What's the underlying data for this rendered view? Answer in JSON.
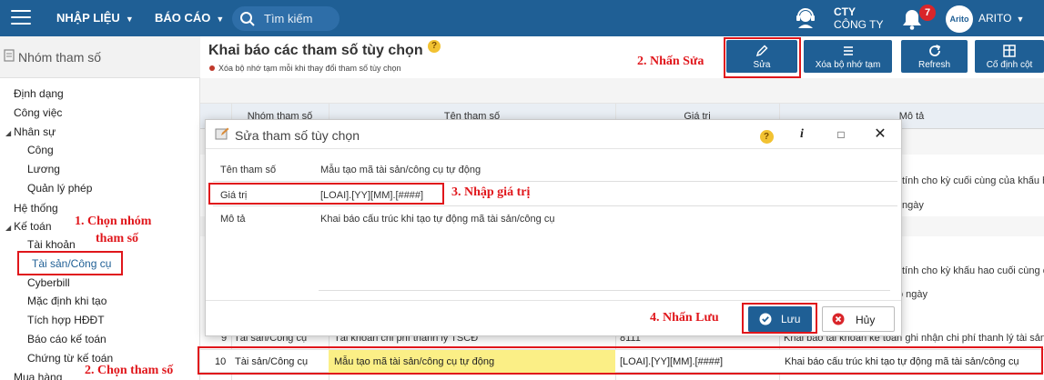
{
  "topbar": {
    "menu1": "NHẬP LIỆU",
    "menu2": "BÁO CÁO",
    "search_placeholder": "Tìm kiếm",
    "company_line1": "CTY",
    "company_line2": "CÔNG TY",
    "notification_count": "7",
    "avatar_text": "Arito",
    "user": "ARITO",
    "color": "#1f5f95"
  },
  "sidebar": {
    "title": "Nhóm tham số",
    "items": [
      {
        "label": "Định dạng"
      },
      {
        "label": "Công việc"
      },
      {
        "label": "Nhân sự"
      },
      {
        "label": "Công"
      },
      {
        "label": "Lương"
      },
      {
        "label": "Quản lý phép"
      },
      {
        "label": "Hệ thống"
      },
      {
        "label": "Kế toán"
      },
      {
        "label": "Tài khoản"
      },
      {
        "label": "Tài sản/Công cụ"
      },
      {
        "label": "Cyberbill"
      },
      {
        "label": "Mặc định khi tạo"
      },
      {
        "label": "Tích hợp HĐĐT"
      },
      {
        "label": "Báo cáo kế toán"
      },
      {
        "label": "Chứng từ kế toán"
      },
      {
        "label": "Mua hàng"
      }
    ]
  },
  "page": {
    "title": "Khai báo các tham số tùy chọn",
    "note": "Xóa bộ nhớ tạm mỗi khi thay đổi tham số tùy chọn"
  },
  "toolbar": {
    "edit": "Sửa",
    "clear_cache": "Xóa bộ nhớ tạm",
    "refresh": "Refresh",
    "fix_column": "Cố định cột"
  },
  "grid": {
    "headers": [
      "Nhóm tham số",
      "Tên tham số",
      "Giá trị",
      "Mô tả"
    ],
    "visible_fragments": [
      "tính cho kỳ cuối cùng của khấu h",
      "ngày",
      "tính cho kỳ khấu hao cuối cùng c",
      "o ngày"
    ],
    "row9": {
      "stt": "9",
      "group": "Tài sản/Công cụ",
      "name": "Tài khoản chi phí thanh lý TSCĐ",
      "value": "8111",
      "desc": "Khai báo tài khoản kế toán ghi nhận chi phí thanh lý tài sản c"
    },
    "row10": {
      "stt": "10",
      "group": "Tài sản/Công cụ",
      "name": "Mẫu tạo mã tài sản/công cụ tự động",
      "value": "[LOAI].[YY][MM].[####]",
      "desc": "Khai báo cấu trúc khi tạo tự động mã tài sản/công cụ"
    }
  },
  "dialog": {
    "title": "Sửa tham số tùy chọn",
    "name_label": "Tên tham số",
    "name_value": "Mẫu tạo mã tài sản/công cụ tự động",
    "value_label": "Giá trị",
    "value_value": "[LOAI].[YY][MM].[####]",
    "desc_label": "Mô tả",
    "desc_value": "Khai báo cấu trúc khi tạo tự động mã tài sản/công cụ",
    "save": "Lưu",
    "cancel": "Hủy"
  },
  "annotations": {
    "step_edit": "2. Nhấn Sửa",
    "step_group_1": "1. Chọn nhóm",
    "step_group_2": "tham số",
    "step_value": "3. Nhập giá trị",
    "step_save": "4. Nhấn Lưu",
    "step_param": "2. Chọn tham số"
  }
}
